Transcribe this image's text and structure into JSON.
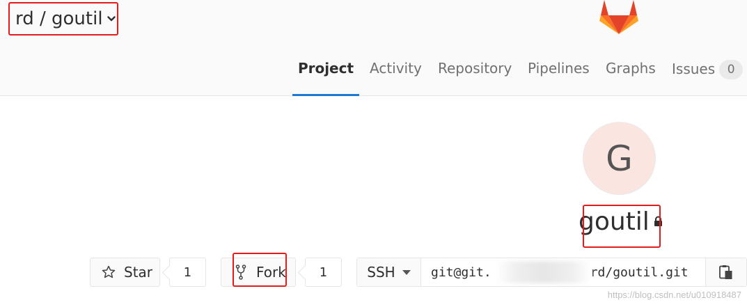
{
  "breadcrumb": {
    "text": "rd / goutil"
  },
  "nav": {
    "tabs": [
      {
        "label": "Project",
        "active": true
      },
      {
        "label": "Activity"
      },
      {
        "label": "Repository"
      },
      {
        "label": "Pipelines"
      },
      {
        "label": "Graphs"
      },
      {
        "label": "Issues",
        "badge": "0"
      }
    ]
  },
  "project": {
    "avatar_letter": "G",
    "name": "goutil",
    "visibility_icon": "lock-icon"
  },
  "actions": {
    "star_label": "Star",
    "star_count": "1",
    "fork_label": "Fork",
    "fork_count": "1"
  },
  "clone": {
    "protocol": "SSH",
    "url_prefix": "git@git.",
    "url_suffix": "rd/goutil.git"
  },
  "watermark": "https://blog.csdn.net/u010918487",
  "colors": {
    "accent": "#1f78d1",
    "highlight": "#e31b1b",
    "avatar_bg": "#fbe5e1",
    "header_bg": "#fafafa"
  }
}
